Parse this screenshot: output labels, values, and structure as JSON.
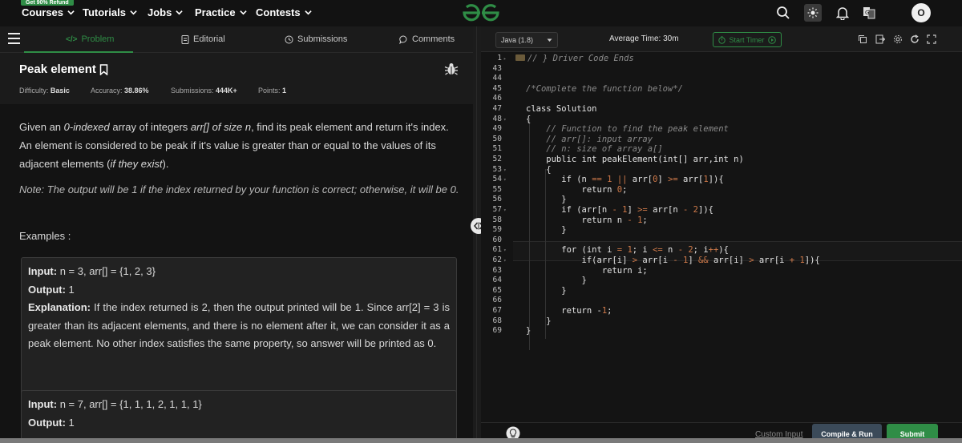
{
  "topnav": {
    "promo": "Get 90% Refund",
    "items": [
      {
        "label": "Courses"
      },
      {
        "label": "Tutorials"
      },
      {
        "label": "Jobs"
      },
      {
        "label": "Practice"
      },
      {
        "label": "Contests"
      }
    ],
    "avatar_initial": "O",
    "icons": [
      "search-icon",
      "theme-toggle-icon",
      "notification-bell-icon",
      "translate-icon"
    ]
  },
  "tabs": {
    "problem": "Problem",
    "editorial": "Editorial",
    "submissions": "Submissions",
    "comments": "Comments"
  },
  "problem": {
    "title": "Peak element",
    "difficulty_label": "Difficulty: ",
    "difficulty": "Basic",
    "accuracy_label": "Accuracy: ",
    "accuracy": "38.86%",
    "submissions_label": "Submissions: ",
    "submissions": "444K+",
    "points_label": "Points: ",
    "points": "1",
    "desc_1": "Given an ",
    "desc_em1": "0-indexed",
    "desc_2": " array of integers ",
    "desc_em2": "arr[] of size n",
    "desc_3": ", find its peak element and return it's index. An element is considered to be peak if it's value is greater than or equal to the values of its adjacent elements (",
    "desc_em3": "if they exist",
    "desc_4": ").",
    "note": "Note: The output will be 1 if the index returned by your function is correct; otherwise, it will be 0.",
    "examples_heading": "Examples :",
    "examples": [
      {
        "input_label": "Input:",
        "input": " n = 3, arr[] = {1, 2, 3}",
        "output_label": "Output:",
        "output": " 1",
        "explanation_label": "Explanation:",
        "explanation": " If the index returned is 2, then the output printed will be 1. Since arr[2] = 3 is greater than its adjacent elements, and there is no element after it, we can consider it as a peak element. No other index satisfies the same property, so answer will be printed as 0."
      },
      {
        "input_label": "Input:",
        "input": " n = 7, arr[] = {1, 1, 1, 2, 1, 1, 1}",
        "output_label": "Output:",
        "output": " 1"
      }
    ]
  },
  "editor": {
    "language": "Java (1.8)",
    "average_time": "Average Time: 30m",
    "start_timer": "Start Timer",
    "custom_input": "Custom Input",
    "compile_run": "Compile & Run",
    "submit": "Submit",
    "line_numbers": [
      "1",
      "43",
      "44",
      "45",
      "46",
      "47",
      "48",
      "49",
      "50",
      "51",
      "52",
      "53",
      "54",
      "55",
      "56",
      "57",
      "58",
      "59",
      "60",
      "61",
      "62",
      "63",
      "64",
      "65",
      "66",
      "67",
      "68",
      "69"
    ],
    "code": [
      "// } Driver Code Ends",
      "",
      "",
      "/*Complete the function below*/",
      "",
      "class Solution",
      "{",
      "    // Function to find the peak element",
      "    // arr[]: input array",
      "    // n: size of array a[]",
      "    public int peakElement(int[] arr,int n)",
      "    {",
      "       if (n == 1 || arr[0] >= arr[1]){",
      "           return 0;",
      "       }",
      "       if (arr[n - 1] >= arr[n - 2]){",
      "           return n - 1;",
      "       }",
      "",
      "       for (int i = 1; i <= n - 2; i++){",
      "           if(arr[i] > arr[i - 1] && arr[i] > arr[i + 1]){",
      "               return i;",
      "           }",
      "       }",
      "",
      "       return -1;",
      "    }",
      "}"
    ]
  }
}
